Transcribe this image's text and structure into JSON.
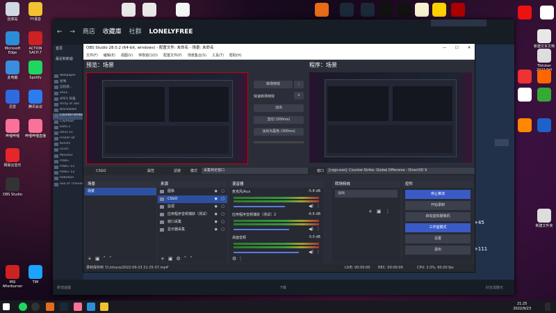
{
  "desktop": {
    "left_icons": [
      {
        "label": "回收站",
        "color": "#cfd8e3"
      },
      {
        "label": "YY语音",
        "color": "#f2c230"
      },
      {
        "label": "Microsoft Edge",
        "color": "#2a8fd8"
      },
      {
        "label": "ACTION SACH.T",
        "color": "#c22"
      },
      {
        "label": "此电脑",
        "color": "#3b8de0"
      },
      {
        "label": "Spotify",
        "color": "#1ed760"
      },
      {
        "label": "迅雷",
        "color": "#2f6be0"
      },
      {
        "label": "腾讯会议",
        "color": "#2b7cf0"
      },
      {
        "label": "哔哩哔哩",
        "color": "#fb7299"
      },
      {
        "label": "哔哩哔哩直播",
        "color": "#fb7299"
      },
      {
        "label": "网易云音乐",
        "color": "#e6262b"
      },
      {
        "label": "OBS Studio",
        "color": "#333"
      },
      {
        "label": "MSI Afterburner",
        "color": "#c22"
      },
      {
        "label": "TIM",
        "color": "#1aa3ff"
      }
    ],
    "right_icons": [
      {
        "label": "",
        "color": "#e11"
      },
      {
        "label": "",
        "color": "#fff"
      },
      {
        "label": "新建文本文档",
        "color": "#e8e8e8"
      },
      {
        "label": "Tiktoker 2022 Pdf",
        "color": "#ddd"
      },
      {
        "label": "",
        "color": "#e33"
      },
      {
        "label": "",
        "color": "#f60"
      },
      {
        "label": "",
        "color": "#fff"
      },
      {
        "label": "",
        "color": "#3a3"
      },
      {
        "label": "新建文件夹",
        "color": "#ddd"
      },
      {
        "label": "",
        "color": "#f80"
      },
      {
        "label": "",
        "color": "#1c62c8"
      }
    ],
    "top_icons": [
      "#e8e8e8",
      "#e8e8e8",
      "#f5f5f5",
      "#e86b1a",
      "#1b2838",
      "#1b2838",
      "#111",
      "#111",
      "#f5f0d0",
      "#ffd000",
      "#a00"
    ]
  },
  "steam": {
    "nav": {
      "store": "商店",
      "library": "收藏庫",
      "community": "社群",
      "user": "LONELYFREE"
    },
    "side_top": "首頁",
    "side_recent": "最近和新遊",
    "games": [
      "Wallpaper",
      "星鳴",
      "远程教...",
      "zAZE",
      "APEX 英雄",
      "Army of Two",
      "Blackwake",
      "Counter-Strike",
      "Cayhead",
      "Dota 2",
      "Deus Ex",
      "Frozen Dr",
      "Kenshi",
      "LEGO",
      "Monster",
      "PUBG",
      "PUBG: Ex",
      "PUBG: Ex",
      "RoboRun",
      "Sea of Thieves"
    ],
    "bottom_left": "新增遊戲",
    "bottom_mid": "下載",
    "bottom_right": "好友與聊天",
    "right_numbers": [
      "+45",
      "+111"
    ]
  },
  "obs": {
    "title": "OBS Studio 28.0.2 (64-bit, windows) - 配置文件: 未命名 - 场景: 未命名",
    "window_controls": [
      "—",
      "☐",
      "✕"
    ],
    "menu": [
      "文件(F)",
      "编辑(E)",
      "视图(V)",
      "停靠窗口(D)",
      "配置文件(P)",
      "场景集合(S)",
      "工具(T)",
      "帮助(H)"
    ],
    "preview_label": "预览：场景",
    "program_label": "程序：场景",
    "transition": {
      "quick_btn": "转场特效",
      "quick_label": "快速转场特效",
      "dropdowns": [
        "淡出",
        "剪切 (300ms)",
        "淡出为黑色 (300ms)"
      ]
    },
    "source_bar": {
      "source": "CSGO",
      "properties": "属性",
      "filters": "滤镜",
      "mode_label": "模式",
      "mode_value": "采集特定窗口",
      "window_label": "窗口",
      "window_value": "[csgo.exe]: Counter-Strike: Global Offensive - Direct3D 9"
    },
    "scenes": {
      "title": "场景",
      "items": [
        "场景"
      ]
    },
    "sources": {
      "title": "来源",
      "items": [
        "图像",
        "CSGO",
        "监视",
        "应用程序音频捕获（测试）",
        "窗口采集",
        "显示器采集"
      ]
    },
    "mixer": {
      "title": "混音器",
      "channels": [
        {
          "name": "麦克风/Aux",
          "db": "-5.8 dB"
        },
        {
          "name": "应用程序音频捕获（测试）2",
          "db": "-6.6 dB"
        },
        {
          "name": "桌面音频",
          "db": "0.0 dB"
        }
      ]
    },
    "transitions_dock": {
      "title": "转场特效",
      "value": "淡出"
    },
    "controls": {
      "title": "控件",
      "buttons": [
        "停止推流",
        "开始录制",
        "启动虚拟摄像机",
        "工作室模式",
        "设置",
        "退出"
      ]
    },
    "status": {
      "recording_path": "录制保存到 'D:/shuca/2022-09-23 21-25-37.mp4'",
      "live": "LIVE: 00:00:00",
      "rec": "REC: 00:00:00",
      "cpu": "CPU: 2.0%, 60.00 fps"
    }
  },
  "taskbar": {
    "time": "21:25",
    "date": "2022/9/23"
  }
}
